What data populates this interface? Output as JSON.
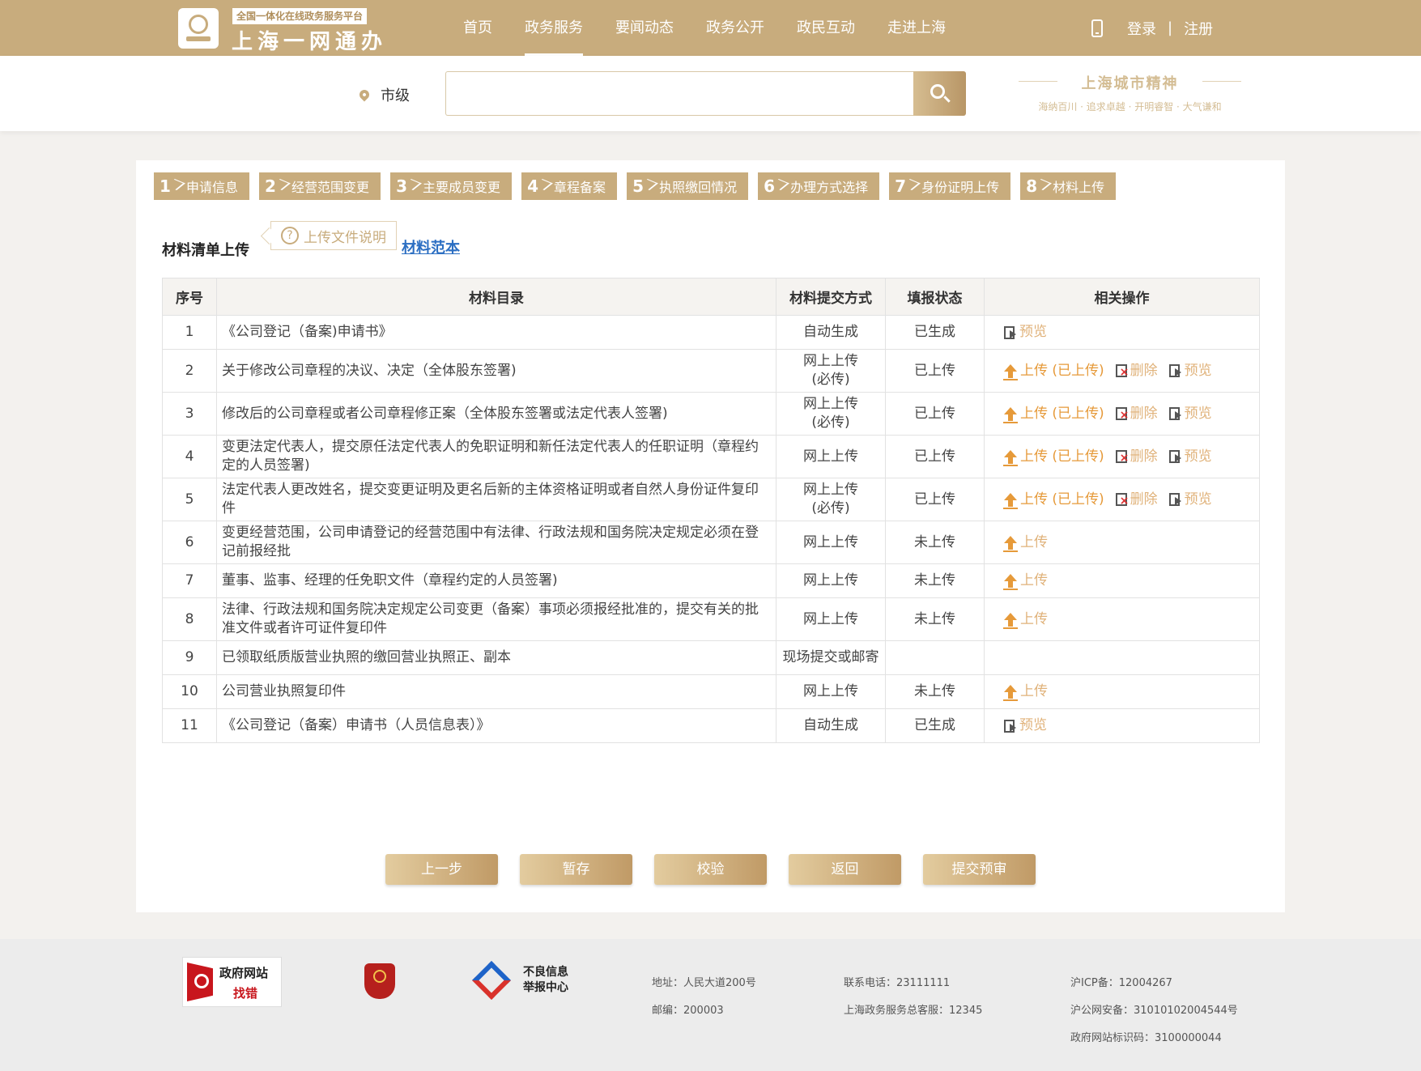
{
  "header": {
    "logo_sub": "全国一体化在线政务服务平台",
    "logo_main": "上海一网通办",
    "nav": [
      "首页",
      "政务服务",
      "要闻动态",
      "政务公开",
      "政民互动",
      "走进上海"
    ],
    "nav_active_index": 1,
    "login": "登录",
    "separator": "|",
    "register": "注册"
  },
  "search": {
    "location": "市级",
    "placeholder": "",
    "value": ""
  },
  "slogan": {
    "title": "上海城市精神",
    "sub": "海纳百川 · 追求卓越 · 开明睿智 · 大气谦和"
  },
  "steps": [
    {
      "num": "1",
      "label": "申请信息"
    },
    {
      "num": "2",
      "label": "经营范围变更"
    },
    {
      "num": "3",
      "label": "主要成员变更"
    },
    {
      "num": "4",
      "label": "章程备案"
    },
    {
      "num": "5",
      "label": "执照缴回情况"
    },
    {
      "num": "6",
      "label": "办理方式选择"
    },
    {
      "num": "7",
      "label": "身份证明上传"
    },
    {
      "num": "8",
      "label": "材料上传"
    }
  ],
  "section": {
    "title": "材料清单上传",
    "upload_tip": "上传文件说明",
    "sample_link": "材料范本"
  },
  "table": {
    "headers": [
      "序号",
      "材料目录",
      "材料提交方式",
      "填报状态",
      "相关操作"
    ],
    "rows": [
      {
        "num": "1",
        "name": "《公司登记（备案)申请书》",
        "mode": "自动生成",
        "state": "已生成",
        "ops": [
          "preview"
        ]
      },
      {
        "num": "2",
        "name": "关于修改公司章程的决议、决定（全体股东签署)",
        "mode": "网上上传\n(必传)",
        "state": "已上传",
        "ops": [
          "uploaded",
          "delete",
          "preview"
        ]
      },
      {
        "num": "3",
        "name": "修改后的公司章程或者公司章程修正案（全体股东签署或法定代表人签署)",
        "mode": "网上上传\n(必传)",
        "state": "已上传",
        "ops": [
          "uploaded",
          "delete",
          "preview"
        ]
      },
      {
        "num": "4",
        "name": "变更法定代表人，提交原任法定代表人的免职证明和新任法定代表人的任职证明（章程约定的人员签署)",
        "mode": "网上上传",
        "state": "已上传",
        "ops": [
          "uploaded",
          "delete",
          "preview"
        ]
      },
      {
        "num": "5",
        "name": "法定代表人更改姓名，提交变更证明及更名后新的主体资格证明或者自然人身份证件复印件",
        "mode": "网上上传\n(必传)",
        "state": "已上传",
        "ops": [
          "uploaded",
          "delete",
          "preview"
        ]
      },
      {
        "num": "6",
        "name": "变更经营范围，公司申请登记的经营范围中有法律、行政法规和国务院决定规定必须在登记前报经批",
        "mode": "网上上传",
        "state": "未上传",
        "ops": [
          "upload"
        ]
      },
      {
        "num": "7",
        "name": "董事、监事、经理的任免职文件（章程约定的人员签署)",
        "mode": "网上上传",
        "state": "未上传",
        "ops": [
          "upload"
        ]
      },
      {
        "num": "8",
        "name": "法律、行政法规和国务院决定规定公司变更（备案）事项必须报经批准的，提交有关的批准文件或者许可证件复印件",
        "mode": "网上上传",
        "state": "未上传",
        "ops": [
          "upload"
        ]
      },
      {
        "num": "9",
        "name": "已领取纸质版营业执照的缴回营业执照正、副本",
        "mode": "现场提交或邮寄",
        "state": "",
        "ops": []
      },
      {
        "num": "10",
        "name": "公司营业执照复印件",
        "mode": "网上上传",
        "state": "未上传",
        "ops": [
          "upload"
        ]
      },
      {
        "num": "11",
        "name": "《公司登记（备案）申请书（人员信息表）》",
        "mode": "自动生成",
        "state": "已生成",
        "ops": [
          "preview"
        ]
      }
    ],
    "op_labels": {
      "upload": "上传",
      "uploaded": "上传 (已上传)",
      "delete": "删除",
      "preview": "预览"
    }
  },
  "buttons": [
    "上一步",
    "暂存",
    "校验",
    "返回",
    "提交预审"
  ],
  "footer": {
    "logo1_line1": "政府网站",
    "logo1_line2": "找错",
    "logo3_line1": "不良信息",
    "logo3_line2": "举报中心",
    "address": "地址：人民大道200号",
    "postcode": "邮编：200003",
    "phone": "联系电话：23111111",
    "hotline": "上海政务服务总客服：12345",
    "icp": "沪ICP备：12004267",
    "security": "沪公网安备：31010102004544号",
    "site_id": "政府网站标识码：3100000044"
  },
  "colors": {
    "brand": "#c8ac7d",
    "op_orange": "#e69a3a",
    "link_blue": "#2b6ec2"
  }
}
